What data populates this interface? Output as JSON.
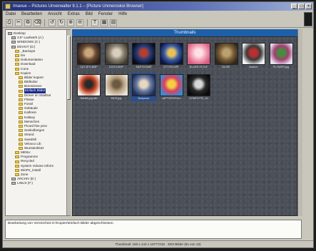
{
  "window": {
    "title": "Imavue – Pictures Unverwalter 9.1.1 – [Picture Unmeroskoi Browser]",
    "controls": [
      "_",
      "□",
      "×"
    ]
  },
  "menu": [
    "Datei",
    "Bearbeiten",
    "Ansicht",
    "Extras",
    "Bild",
    "Fenster",
    "Hilfe"
  ],
  "toolbar": [
    "⎙",
    "✂",
    "⧉",
    "⌫",
    "↺",
    "↻",
    "⊕",
    "⊖",
    "T",
    "▦",
    "▤"
  ],
  "tree": {
    "items": [
      {
        "label": "Desktop",
        "type": "drive",
        "indent": 0
      },
      {
        "label": "3,5\"-Laufwerk (A:)",
        "type": "drive",
        "indent": 1
      },
      {
        "label": "WINDOWS (C:)",
        "type": "drive",
        "indent": 1
      },
      {
        "label": "DEVKIT (D:)",
        "type": "drive",
        "indent": 1
      },
      {
        "label": "_Backups",
        "type": "folder",
        "indent": 2
      },
      {
        "label": "bin",
        "type": "folder",
        "indent": 2
      },
      {
        "label": "Dokumentation",
        "type": "folder",
        "indent": 2
      },
      {
        "label": "Download",
        "type": "folder",
        "indent": 2
      },
      {
        "label": "Icons",
        "type": "folder",
        "indent": 2
      },
      {
        "label": "Kopien",
        "type": "folder",
        "indent": 2
      },
      {
        "label": "Bilder kopiert",
        "type": "folder",
        "indent": 3
      },
      {
        "label": "Bildkultur",
        "type": "folder",
        "indent": 3
      },
      {
        "label": "Büroszenen",
        "type": "folder",
        "indent": 3
      },
      {
        "label": "Einfach Bilder",
        "type": "folder",
        "indent": 3,
        "selected": true
      },
      {
        "label": "Dinner im Stadtrat",
        "type": "folder",
        "indent": 3
      },
      {
        "label": "Flösse",
        "type": "folder",
        "indent": 3
      },
      {
        "label": "Fossil",
        "type": "folder",
        "indent": 3
      },
      {
        "label": "Gebäude",
        "type": "folder",
        "indent": 3
      },
      {
        "label": "Kathrein",
        "type": "folder",
        "indent": 3
      },
      {
        "label": "Kaltaxy",
        "type": "folder",
        "indent": 3
      },
      {
        "label": "Menschen",
        "type": "folder",
        "indent": 3
      },
      {
        "label": "Picard fine prev",
        "type": "folder",
        "indent": 3
      },
      {
        "label": "Seekulbergen",
        "type": "folder",
        "indent": 3
      },
      {
        "label": "Strand",
        "type": "folder",
        "indent": 3
      },
      {
        "label": "Swedish",
        "type": "folder",
        "indent": 3
      },
      {
        "label": "Veloxco Lib",
        "type": "folder",
        "indent": 3
      },
      {
        "label": "Wunstenklotz",
        "type": "folder",
        "indent": 3
      },
      {
        "label": "MENU",
        "type": "folder",
        "indent": 2
      },
      {
        "label": "Programme",
        "type": "folder",
        "indent": 2
      },
      {
        "label": "Recycled",
        "type": "folder",
        "indent": 2
      },
      {
        "label": "System Volume Inform",
        "type": "folder",
        "indent": 2
      },
      {
        "label": "WinPe_install",
        "type": "folder",
        "indent": 2
      },
      {
        "label": "Zone",
        "type": "folder",
        "indent": 2
      },
      {
        "label": "ARCHIV (E:)",
        "type": "drive",
        "indent": 1
      },
      {
        "label": "LINUX (F:)",
        "type": "drive",
        "indent": 1
      }
    ]
  },
  "panel": {
    "title": "Thumbnails"
  },
  "thumbnails": [
    {
      "caption": "CAT.JPG.BMP",
      "colors": [
        "#2a1f1a",
        "#6a4b34",
        "#c9a77d"
      ]
    },
    {
      "caption": "DOGS.BMP",
      "colors": [
        "#3f3a30",
        "#8d8272",
        "#d8cfbf"
      ]
    },
    {
      "caption": "EARTH.BMP",
      "colors": [
        "#0a0a14",
        "#1f3a7a",
        "#b04030"
      ]
    },
    {
      "caption": "CITYSCAPE",
      "colors": [
        "#0a1540",
        "#3b5fa8",
        "#e6c15a"
      ]
    },
    {
      "caption": "BLUEEYE.GIF",
      "colors": [
        "#d85a80",
        "#f3a6b8",
        "#ffe0e8"
      ]
    },
    {
      "caption": "MLIFE",
      "colors": [
        "#30261a",
        "#7a6038",
        "#bda070"
      ]
    },
    {
      "caption": "Banner",
      "colors": [
        "#f4f4f4",
        "#3a3a3a",
        "#b83030"
      ]
    },
    {
      "caption": "FLOWER.jpg",
      "colors": [
        "#e8e0f0",
        "#a04070",
        "#4a8a40"
      ]
    },
    {
      "caption": "Rabbit.jpg.bild",
      "colors": [
        "#f6f3ea",
        "#c44020",
        "#2a2a2a"
      ]
    },
    {
      "caption": "KIDS.jpg",
      "colors": [
        "#e8e4d8",
        "#b8a080",
        "#6a5a40"
      ]
    },
    {
      "caption": "Bodyman",
      "colors": [
        "#1f2f5a",
        "#6a7aa0",
        "#e8d8c0"
      ],
      "selected": true
    },
    {
      "caption": "LAPTOPIXF.bm",
      "colors": [
        "#3a8ad0",
        "#e04060",
        "#f0d040"
      ]
    },
    {
      "caption": "COMPUTR_Lin",
      "colors": [
        "#0a0a0a",
        "#2a2a2a",
        "#d8d8d8"
      ]
    }
  ],
  "status_panel": {
    "text": "Bearbeitung von Verzeichnis D:\\Kopien\\Einfach Bilder abgeschlossen."
  },
  "statusbar": {
    "text": "Thumbnail: 160 x 144 x 16777216 · 30/3 Bilder (81 von 13)"
  }
}
